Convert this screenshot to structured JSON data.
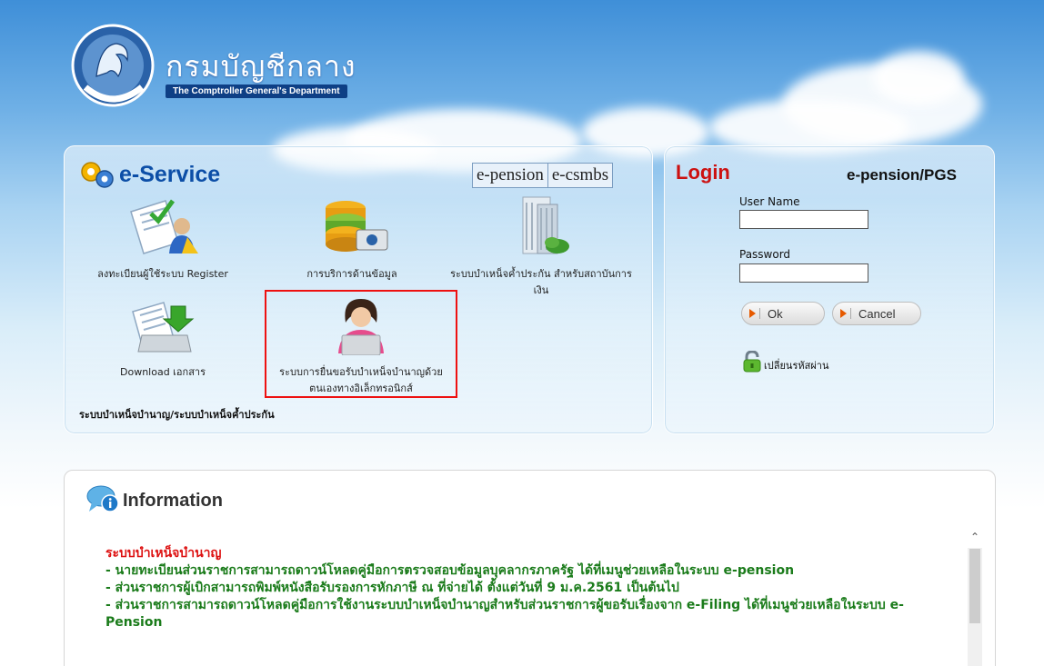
{
  "header": {
    "org_name_th": "กรมบัญชีกลาง",
    "org_name_en": "The Comptroller General's Department"
  },
  "eservice": {
    "title": "e-Service",
    "tabs": [
      "e-pension",
      "e-csmbs"
    ],
    "items": [
      {
        "label": "ลงทะเบียนผู้ใช้ระบบ Register",
        "icon": "register-document-user-icon"
      },
      {
        "label": "การบริการด้านข้อมูล",
        "icon": "database-service-icon"
      },
      {
        "label": "ระบบบำเหน็จค้ำประกัน สำหรับสถาบันการเงิน",
        "icon": "building-icon"
      },
      {
        "label": "Download เอกสาร",
        "icon": "download-document-icon"
      },
      {
        "label": "ระบบการยื่นขอรับบำเหน็จบำนาญด้วยตนเองทางอิเล็กทรอนิกส์",
        "icon": "user-laptop-icon"
      }
    ],
    "footer": "ระบบบำเหน็จบำนาญ/ระบบบำเหน็จค้ำประกัน"
  },
  "login": {
    "title": "Login",
    "system": "e-pension/PGS",
    "username_label": "User Name",
    "username_value": "",
    "password_label": "Password",
    "password_value": "",
    "ok_label": "Ok",
    "cancel_label": "Cancel",
    "change_password": "เปลี่ยนรหัสผ่าน"
  },
  "info": {
    "title": "Information",
    "category": "ระบบบำเหน็จบำนาญ",
    "items": [
      "- นายทะเบียนส่วนราชการสามารถดาวน์โหลดคู่มือการตรวจสอบข้อมูลบุคลากรภาครัฐ ได้ที่เมนูช่วยเหลือในระบบ e-pension",
      "- ส่วนราชการผู้เบิกสามารถพิมพ์หนังสือรับรองการหักภาษี ณ ที่จ่ายได้ ตั้งแต่วันที่ 9 ม.ค.2561 เป็นต้นไป",
      "- ส่วนราชการสามารถดาวน์โหลดคู่มือการใช้งานระบบบำเหน็จบำนาญสำหรับส่วนราชการผู้ขอรับเรื่องจาก e-Filing ได้ที่เมนูช่วยเหลือในระบบ e-Pension"
    ]
  },
  "colors": {
    "eservice_title": "#0c4ea7",
    "login_title": "#cc1111",
    "info_category": "#dd1111",
    "info_item": "#1a7b1a",
    "highlight_border": "#ee1111"
  }
}
